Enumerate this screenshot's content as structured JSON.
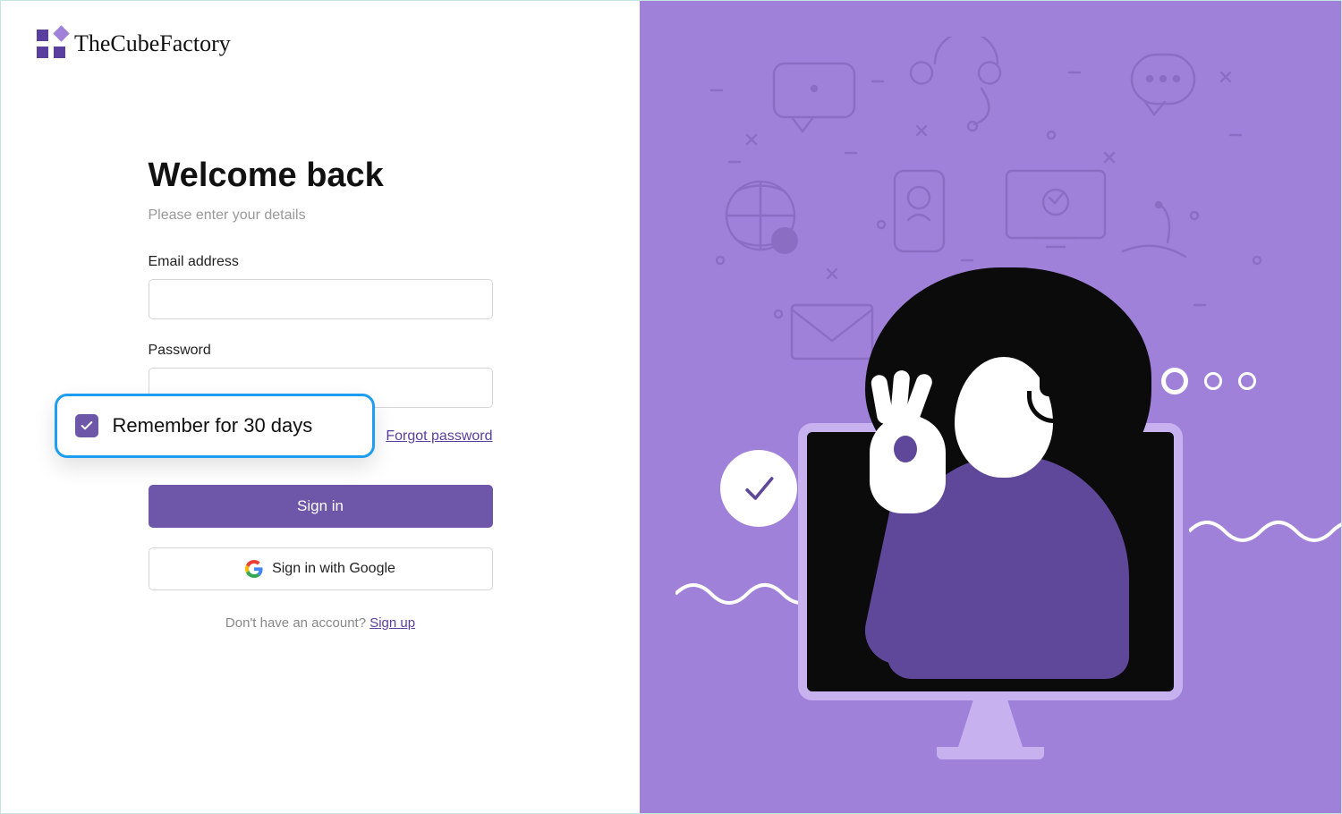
{
  "brand": {
    "name": "TheCubeFactory"
  },
  "form": {
    "heading": "Welcome back",
    "subheading": "Please enter your details",
    "email_label": "Email address",
    "password_label": "Password",
    "remember_label": "Remember for 30 days",
    "forgot_label": "Forgot password",
    "signin_label": "Sign in",
    "google_label": "Sign in with Google",
    "footer_prompt": "Don't have an account?  ",
    "signup_label": "Sign up"
  }
}
